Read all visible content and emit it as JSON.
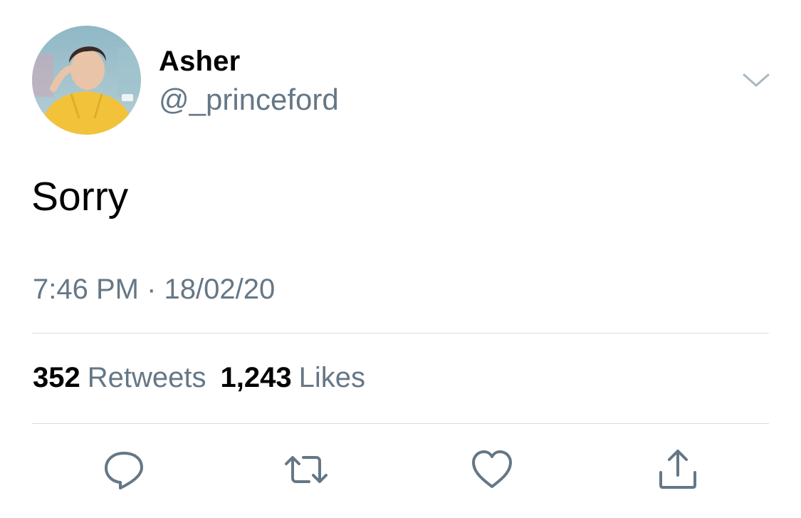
{
  "tweet": {
    "author": {
      "display_name": "Asher",
      "handle": "@_princeford"
    },
    "text": "Sorry",
    "timestamp": "7:46 PM · 18/02/20",
    "stats": {
      "retweets_count": "352",
      "retweets_label": "Retweets",
      "likes_count": "1,243",
      "likes_label": "Likes"
    }
  },
  "icons": {
    "menu": "chevron-down-icon",
    "reply": "reply-icon",
    "retweet": "retweet-icon",
    "like": "heart-icon",
    "share": "share-icon"
  },
  "colors": {
    "text_primary": "#000000",
    "text_secondary": "#657786",
    "divider": "#d6dde3",
    "icon": "#657786"
  }
}
